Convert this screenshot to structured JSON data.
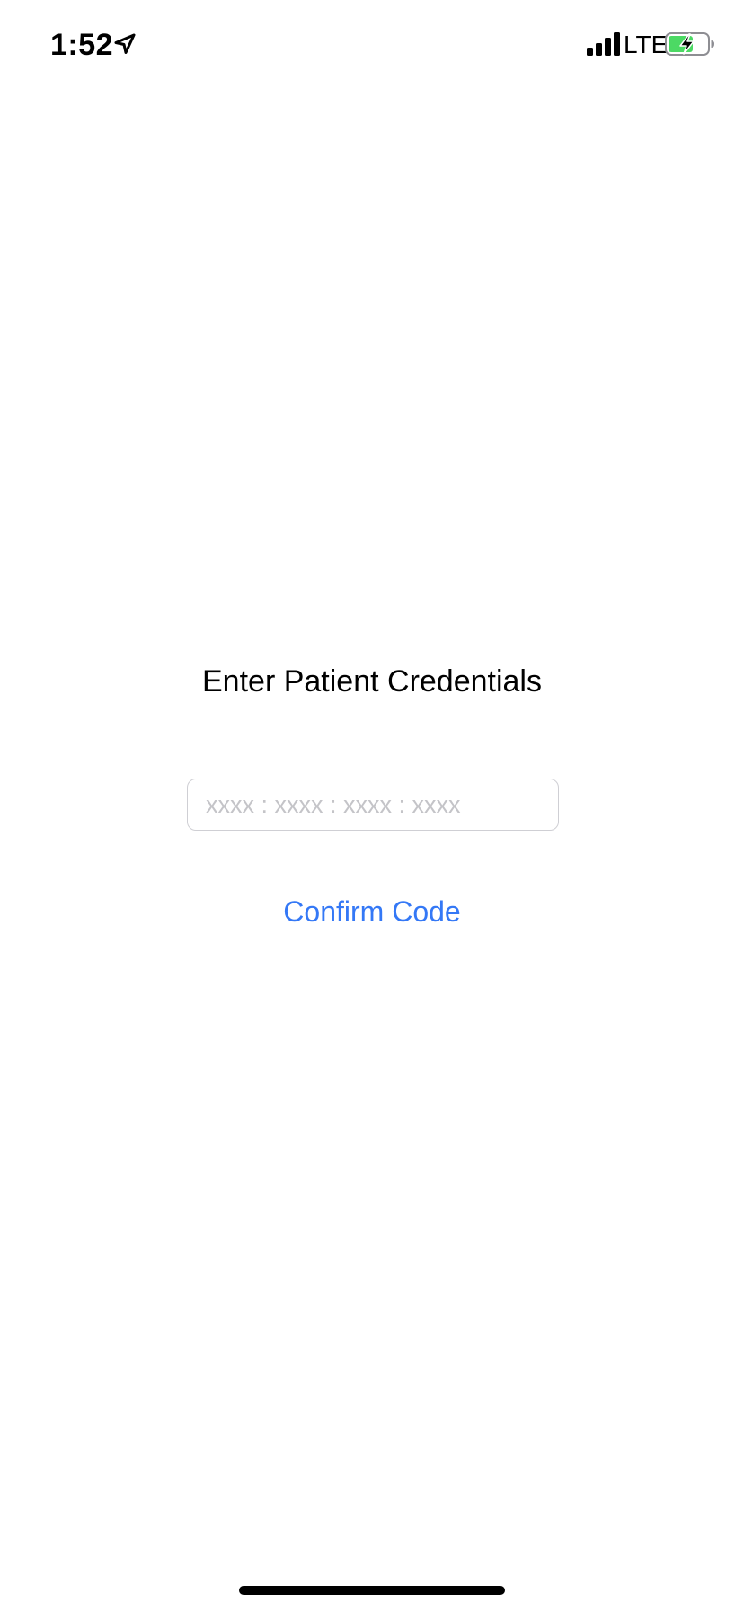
{
  "status_bar": {
    "time": "1:52",
    "network": "LTE",
    "icons": [
      "location-arrow-icon",
      "cellular-signal-icon",
      "battery-charging-icon"
    ],
    "battery_color": "#4cd964"
  },
  "main": {
    "title": "Enter Patient Credentials",
    "code_input": {
      "placeholder": "xxxx : xxxx : xxxx : xxxx",
      "value": ""
    },
    "confirm_label": "Confirm Code"
  },
  "colors": {
    "accent": "#3478f6",
    "input_border": "#cfcfd4",
    "placeholder": "#c4c4c8",
    "background": "#ffffff"
  }
}
